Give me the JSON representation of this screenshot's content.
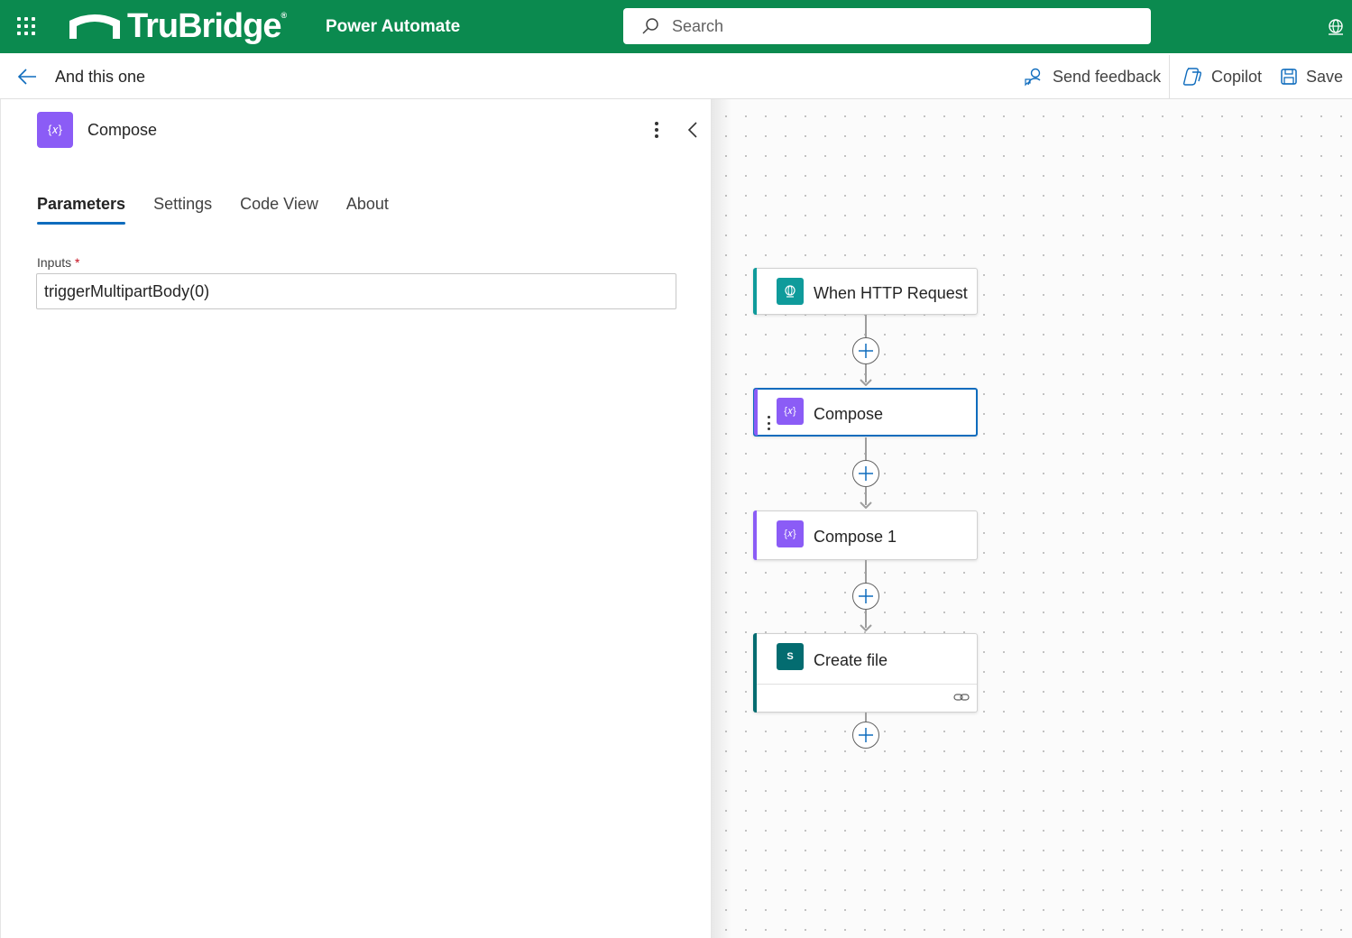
{
  "topbar": {
    "brand": "TruBridge",
    "brand_mark": "®",
    "app_name": "Power Automate",
    "search_placeholder": "Search"
  },
  "cmdbar": {
    "flow_name": "And this one",
    "send_feedback": "Send feedback",
    "copilot": "Copilot",
    "save": "Save"
  },
  "panel": {
    "title": "Compose",
    "tabs": [
      "Parameters",
      "Settings",
      "Code View",
      "About"
    ],
    "active_tab": "Parameters",
    "inputs_label": "Inputs",
    "required_marker": "*",
    "inputs_value": "triggerMultipartBody(0)"
  },
  "flow": {
    "nodes": [
      {
        "title": "When HTTP Request",
        "color": "#0f9b9b",
        "icon": "globe-icon"
      },
      {
        "title": "Compose",
        "color": "#8b5cf6",
        "icon": "variable-icon",
        "selected": true
      },
      {
        "title": "Compose 1",
        "color": "#8b5cf6",
        "icon": "variable-icon"
      },
      {
        "title": "Create file",
        "color": "#036c70",
        "icon": "sharepoint-icon"
      }
    ]
  },
  "colors": {
    "topbar": "#0b8a4f",
    "accent": "#0f6cbd",
    "compose": "#8b5cf6",
    "http": "#0f9b9b",
    "sharepoint": "#036c70"
  }
}
